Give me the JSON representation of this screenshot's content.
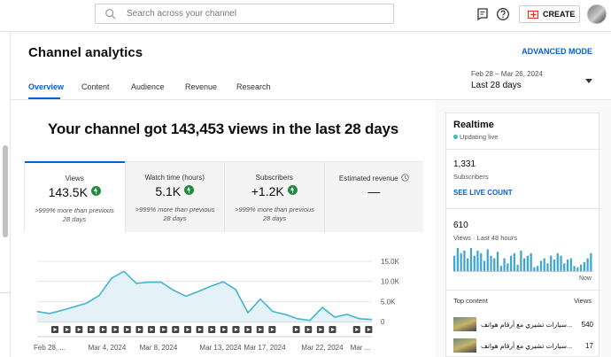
{
  "topbar": {
    "search_placeholder": "Search across your channel",
    "create_label": "CREATE",
    "icons": [
      "search-icon",
      "messages-icon",
      "help-icon",
      "create-icon",
      "avatar"
    ]
  },
  "header": {
    "title": "Channel analytics",
    "advanced_mode": "ADVANCED MODE",
    "tabs": [
      "Overview",
      "Content",
      "Audience",
      "Revenue",
      "Research"
    ],
    "active_tab": "Overview",
    "date_range_label": "Feb 28 – Mar 26, 2024",
    "date_range_value": "Last 28 days"
  },
  "main": {
    "headline": "Your channel got 143,453 views in the last 28 days",
    "metrics": [
      {
        "label": "Views",
        "value": "143.5K",
        "sub": ">999% more than previous 28 days",
        "trend": "up"
      },
      {
        "label": "Watch time (hours)",
        "value": "5.1K",
        "sub": ">999% more than previous 28 days",
        "trend": "up"
      },
      {
        "label": "Subscribers",
        "value": "+1.2K",
        "sub": ">999% more than previous 28 days",
        "trend": "up"
      },
      {
        "label": "Estimated revenue",
        "value": "—",
        "sub": "",
        "trend": "none"
      }
    ]
  },
  "chart_data": {
    "type": "area",
    "x": [
      "Feb 28",
      "Feb 29",
      "Mar 1",
      "Mar 2",
      "Mar 3",
      "Mar 4",
      "Mar 5",
      "Mar 6",
      "Mar 7",
      "Mar 8",
      "Mar 9",
      "Mar 10",
      "Mar 11",
      "Mar 12",
      "Mar 13",
      "Mar 14",
      "Mar 15",
      "Mar 16",
      "Mar 17",
      "Mar 18",
      "Mar 19",
      "Mar 20",
      "Mar 21",
      "Mar 22",
      "Mar 23",
      "Mar 24",
      "Mar 25",
      "Mar 26"
    ],
    "x_tick_labels": [
      "Feb 28, ...",
      "Mar 4, 2024",
      "Mar 8, 2024",
      "Mar 13, 2024",
      "Mar 17, 2024",
      "Mar 22, 2024",
      "Mar ..."
    ],
    "series": [
      {
        "values": [
          2500,
          2000,
          2800,
          3700,
          4600,
          6500,
          10800,
          12500,
          9500,
          9800,
          9800,
          7800,
          6300,
          7500,
          8800,
          9900,
          8000,
          2200,
          5600,
          2500,
          1800,
          700,
          300,
          3500,
          1100,
          1800,
          700,
          500
        ]
      }
    ],
    "ylim": [
      0,
      15000
    ],
    "y_tick_labels": [
      "15.0K",
      "10.0K",
      "5.0K",
      "0"
    ],
    "color": "#41b4d1",
    "fill": "#e4f2f8",
    "grid": true,
    "video_markers": 27
  },
  "realtime": {
    "title": "Realtime",
    "status": "Updating live",
    "subscribers_value": "1,331",
    "subscribers_label": "Subscribers",
    "see_live": "SEE LIVE COUNT",
    "views_value": "610",
    "views_label": "Views · Last 48 hours",
    "now_label": "Now",
    "bar_values": [
      12,
      18,
      14,
      16,
      10,
      18,
      12,
      16,
      14,
      8,
      17,
      12,
      10,
      15,
      4,
      10,
      6,
      12,
      14,
      5,
      16,
      10,
      12,
      14,
      3,
      4,
      8,
      10,
      6,
      12,
      9,
      14,
      12,
      6,
      9,
      10,
      4,
      3,
      5,
      7,
      10,
      14
    ],
    "top_content_label": "Top content",
    "top_views_label": "Views",
    "top_items": [
      {
        "title": "سيارات تشيري مع أرقام هواتف...",
        "views": "540"
      },
      {
        "title": "سيارات تشيري مع أرقام هواتف...",
        "views": "17"
      }
    ]
  }
}
